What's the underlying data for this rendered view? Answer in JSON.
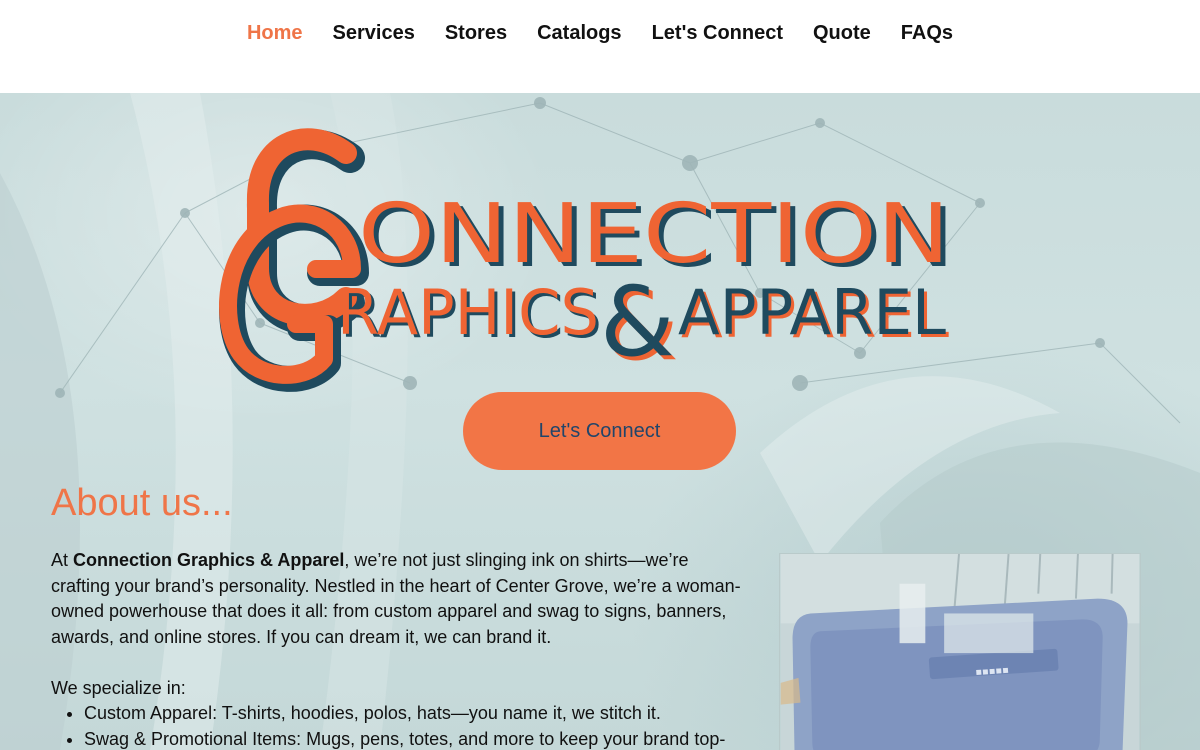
{
  "nav": {
    "items": [
      {
        "label": "Home",
        "active": true
      },
      {
        "label": "Services"
      },
      {
        "label": "Stores"
      },
      {
        "label": "Catalogs"
      },
      {
        "label": "Let's Connect"
      },
      {
        "label": "Quote"
      },
      {
        "label": "FAQs"
      }
    ]
  },
  "logo": {
    "line1": "ONNECTION",
    "line2a": "RAPHICS",
    "amp": "&",
    "line2b": "APPAREL"
  },
  "hero": {
    "cta_label": "Let's Connect"
  },
  "about": {
    "title": "About us...",
    "intro_prefix": "At ",
    "company": "Connection Graphics & Apparel",
    "intro_rest": ", we’re not just slinging ink on shirts—we’re crafting your brand’s personality. Nestled in the heart of Center Grove, we’re a woman-owned powerhouse that does it all: from custom apparel and swag to signs, banners, awards, and online stores. If you can dream it, we can brand it.",
    "specialize_intro": "We specialize in:",
    "specialties": [
      "Custom Apparel: T-shirts, hoodies, polos, hats—you name it, we stitch it.",
      "Swag & Promotional Items: Mugs, pens, totes, and more to keep your brand top-"
    ]
  },
  "colors": {
    "accent": "#ef7548",
    "navy": "#1f4a5e",
    "cta_text": "#21456a"
  }
}
